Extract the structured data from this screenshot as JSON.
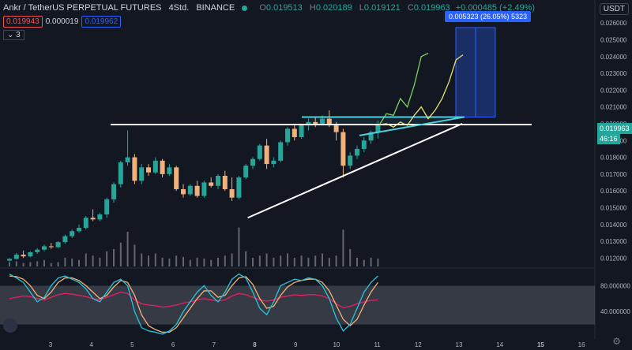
{
  "header": {
    "symbol": "Ankr / TetherUS PERPETUAL FUTURES",
    "interval": "4Std.",
    "exchange": "BINANCE",
    "o_label": "O",
    "o_val": "0.019513",
    "h_label": "H",
    "h_val": "0.020189",
    "l_label": "L",
    "l_val": "0.019121",
    "c_label": "C",
    "c_val": "0.019963",
    "change": "+0.000485 (+2.49%)",
    "bid": "0.019943",
    "spread": "0.000019",
    "ask": "0.019962",
    "indicators_count": "3",
    "currency": "USDT"
  },
  "measure_label": "0.005323 (26.05%) 5323",
  "last_price_tag": "0.019963",
  "countdown_tag": "46:16",
  "colors": {
    "bg": "#131722",
    "up": "#26a69a",
    "down": "#f0b27a",
    "accent": "#2962ff",
    "cyan": "#4dd0e1",
    "white": "#ffffff",
    "yellow": "#e6e17a",
    "green": "#7cd35a",
    "stoch_k": "#26c6da",
    "stoch_d": "#f0b27a",
    "rsi": "#e91e63"
  },
  "icons": {
    "logo": "tradingview-logo-icon",
    "settings": "gear-icon",
    "eye": "eye-icon"
  },
  "chart_data": {
    "type": "candlestick",
    "price_axis": {
      "range": [
        0.0115,
        0.0269
      ],
      "ticks": [
        "0.026000",
        "0.025000",
        "0.024000",
        "0.023000",
        "0.022000",
        "0.021000",
        "0.020000",
        "0.019000",
        "0.018000",
        "0.017000",
        "0.016000",
        "0.015000",
        "0.014000",
        "0.013000",
        "0.012000"
      ]
    },
    "x_axis": {
      "ticks": [
        "3",
        "4",
        "5",
        "6",
        "7",
        "8",
        "9",
        "10",
        "11",
        "12",
        "13",
        "14",
        "15",
        "16"
      ],
      "bold": [
        "8",
        "15"
      ]
    },
    "candles": [
      [
        0.01185,
        0.012,
        0.0118,
        0.01195
      ],
      [
        0.01195,
        0.0123,
        0.0119,
        0.0122
      ],
      [
        0.0122,
        0.01245,
        0.012,
        0.0121
      ],
      [
        0.0121,
        0.0124,
        0.01205,
        0.01235
      ],
      [
        0.01235,
        0.0126,
        0.01225,
        0.0125
      ],
      [
        0.0125,
        0.0128,
        0.0124,
        0.0127
      ],
      [
        0.0127,
        0.0129,
        0.01255,
        0.01265
      ],
      [
        0.01265,
        0.013,
        0.0126,
        0.01295
      ],
      [
        0.01295,
        0.0134,
        0.01285,
        0.0133
      ],
      [
        0.0133,
        0.0137,
        0.0132,
        0.0136
      ],
      [
        0.0136,
        0.014,
        0.0135,
        0.0138
      ],
      [
        0.0138,
        0.0145,
        0.0137,
        0.0144
      ],
      [
        0.0144,
        0.0149,
        0.0142,
        0.0143
      ],
      [
        0.0143,
        0.0147,
        0.0142,
        0.0146
      ],
      [
        0.0146,
        0.0156,
        0.0144,
        0.0155
      ],
      [
        0.0155,
        0.0165,
        0.0153,
        0.0164
      ],
      [
        0.0164,
        0.0178,
        0.0162,
        0.0177
      ],
      [
        0.0177,
        0.0196,
        0.0175,
        0.018
      ],
      [
        0.018,
        0.0182,
        0.0164,
        0.0166
      ],
      [
        0.0166,
        0.0176,
        0.0164,
        0.0174
      ],
      [
        0.0174,
        0.0176,
        0.0169,
        0.0171
      ],
      [
        0.0171,
        0.018,
        0.017,
        0.0178
      ],
      [
        0.0178,
        0.0179,
        0.0168,
        0.017
      ],
      [
        0.017,
        0.0176,
        0.0169,
        0.0174
      ],
      [
        0.0174,
        0.0175,
        0.016,
        0.0161
      ],
      [
        0.0161,
        0.0164,
        0.0156,
        0.0158
      ],
      [
        0.0158,
        0.0164,
        0.0157,
        0.0163
      ],
      [
        0.0163,
        0.0166,
        0.0156,
        0.0157
      ],
      [
        0.0157,
        0.0166,
        0.0156,
        0.0165
      ],
      [
        0.0165,
        0.0168,
        0.0162,
        0.0163
      ],
      [
        0.0163,
        0.017,
        0.0161,
        0.0169
      ],
      [
        0.0169,
        0.0172,
        0.016,
        0.0161
      ],
      [
        0.0161,
        0.0168,
        0.0154,
        0.0156
      ],
      [
        0.0156,
        0.0169,
        0.0155,
        0.0168
      ],
      [
        0.0168,
        0.0176,
        0.0167,
        0.0175
      ],
      [
        0.0175,
        0.018,
        0.0173,
        0.0179
      ],
      [
        0.0179,
        0.0188,
        0.0178,
        0.0187
      ],
      [
        0.0187,
        0.0191,
        0.0173,
        0.0176
      ],
      [
        0.0176,
        0.018,
        0.0174,
        0.0178
      ],
      [
        0.0178,
        0.019,
        0.0177,
        0.0189
      ],
      [
        0.0189,
        0.0198,
        0.0187,
        0.0197
      ],
      [
        0.0197,
        0.0199,
        0.019,
        0.0192
      ],
      [
        0.0192,
        0.02,
        0.0191,
        0.0199
      ],
      [
        0.0199,
        0.0203,
        0.0196,
        0.0201
      ],
      [
        0.0201,
        0.0204,
        0.0198,
        0.02
      ],
      [
        0.02,
        0.0205,
        0.0199,
        0.0203
      ],
      [
        0.0203,
        0.0208,
        0.0198,
        0.0199
      ],
      [
        0.0199,
        0.0201,
        0.019,
        0.0195
      ],
      [
        0.0195,
        0.0197,
        0.0168,
        0.0175
      ],
      [
        0.0175,
        0.0183,
        0.0173,
        0.0181
      ],
      [
        0.0181,
        0.0187,
        0.0179,
        0.0185
      ],
      [
        0.0185,
        0.0192,
        0.0183,
        0.019
      ],
      [
        0.019,
        0.0196,
        0.0188,
        0.0195
      ],
      [
        0.0195,
        0.02019,
        0.01912,
        0.01996
      ]
    ],
    "volume": [
      0.1,
      0.12,
      0.08,
      0.1,
      0.12,
      0.15,
      0.08,
      0.1,
      0.2,
      0.18,
      0.15,
      0.3,
      0.25,
      0.2,
      0.35,
      0.4,
      0.55,
      0.8,
      0.5,
      0.3,
      0.25,
      0.3,
      0.2,
      0.18,
      0.25,
      0.22,
      0.15,
      0.2,
      0.18,
      0.15,
      0.2,
      0.25,
      0.3,
      0.9,
      0.35,
      0.2,
      0.25,
      0.3,
      0.2,
      0.25,
      0.3,
      0.2,
      0.25,
      0.2,
      0.25,
      0.3,
      0.2,
      0.25,
      0.85,
      0.4,
      0.2,
      0.15,
      0.2,
      0.18
    ],
    "oscillator": {
      "range": [
        0,
        100
      ],
      "ticks": [
        "80.000000",
        "40.000000"
      ],
      "band": [
        20,
        80
      ],
      "k": [
        98,
        92,
        85,
        70,
        55,
        62,
        80,
        92,
        95,
        90,
        85,
        75,
        60,
        55,
        70,
        85,
        90,
        80,
        40,
        15,
        10,
        8,
        5,
        10,
        20,
        40,
        55,
        70,
        80,
        65,
        55,
        70,
        90,
        98,
        92,
        70,
        45,
        35,
        55,
        80,
        85,
        90,
        88,
        92,
        90,
        80,
        60,
        30,
        10,
        20,
        45,
        70,
        85,
        95
      ],
      "d": [
        95,
        94,
        90,
        80,
        65,
        60,
        70,
        85,
        92,
        92,
        88,
        80,
        70,
        60,
        65,
        78,
        88,
        85,
        65,
        35,
        18,
        12,
        8,
        8,
        15,
        30,
        45,
        60,
        72,
        72,
        62,
        65,
        80,
        92,
        94,
        82,
        60,
        45,
        48,
        65,
        78,
        85,
        88,
        90,
        90,
        85,
        72,
        50,
        28,
        18,
        28,
        50,
        70,
        85
      ],
      "rsi": [
        60,
        62,
        64,
        63,
        60,
        58,
        62,
        66,
        68,
        67,
        65,
        63,
        60,
        58,
        62,
        66,
        70,
        68,
        58,
        52,
        50,
        49,
        47,
        48,
        50,
        53,
        55,
        58,
        60,
        58,
        56,
        58,
        64,
        68,
        66,
        62,
        58,
        56,
        58,
        62,
        64,
        66,
        65,
        66,
        66,
        64,
        60,
        52,
        46,
        48,
        52,
        55,
        57,
        58
      ]
    },
    "annotations": {
      "resistance_level": 0.01995,
      "upper_zone": [
        0.02,
        0.0204
      ],
      "support_trend": {
        "from": [
          32,
          0.0144
        ],
        "to": [
          60,
          0.02
        ]
      },
      "cyan_line": {
        "from": [
          43,
          0.0204
        ],
        "to": [
          63,
          0.0204
        ]
      },
      "measure": {
        "from": 0.0204,
        "to": 0.02573
      },
      "projection_1": [
        [
          53,
          0.01995
        ],
        [
          54,
          0.0206
        ],
        [
          55,
          0.0205
        ],
        [
          56,
          0.0215
        ],
        [
          57,
          0.021
        ],
        [
          58,
          0.0223
        ],
        [
          59,
          0.024
        ],
        [
          60,
          0.0242
        ]
      ],
      "projection_2": [
        [
          53,
          0.01995
        ],
        [
          54,
          0.02
        ],
        [
          55,
          0.0198
        ],
        [
          56,
          0.0201
        ],
        [
          57,
          0.0199
        ],
        [
          58,
          0.0205
        ],
        [
          59,
          0.021
        ],
        [
          60,
          0.0203
        ],
        [
          61,
          0.0208
        ],
        [
          62,
          0.0215
        ],
        [
          63,
          0.0225
        ],
        [
          64,
          0.0238
        ],
        [
          65,
          0.0241
        ]
      ]
    }
  }
}
